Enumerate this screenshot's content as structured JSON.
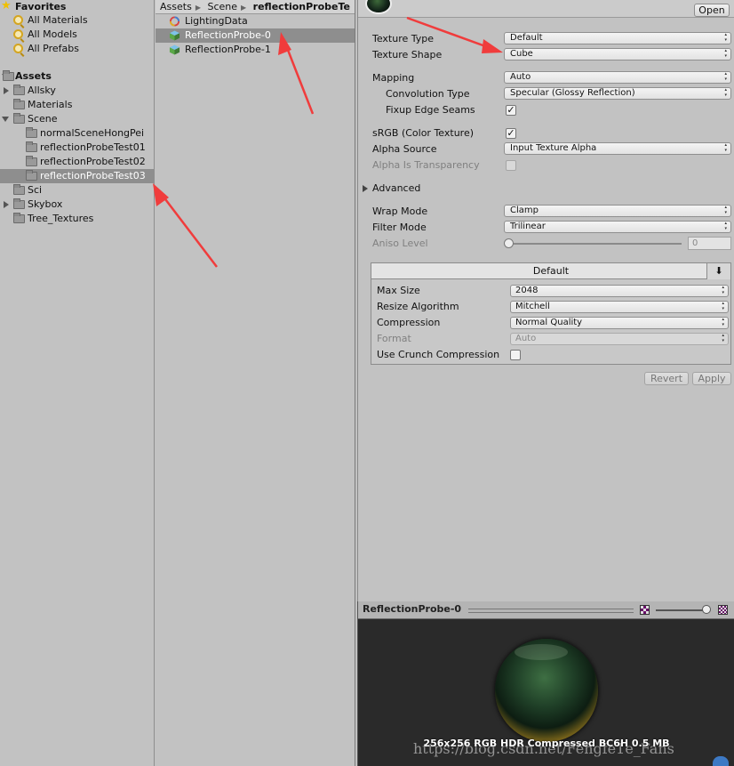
{
  "tree": {
    "favorites_label": "Favorites",
    "favorites": [
      "All Materials",
      "All Models",
      "All Prefabs"
    ],
    "assets_label": "Assets",
    "items": {
      "allsky": "Allsky",
      "materials": "Materials",
      "scene": "Scene",
      "scene_children": [
        "normalSceneHongPei",
        "reflectionProbeTest01",
        "reflectionProbeTest02",
        "reflectionProbeTest03"
      ],
      "sci": "Sci",
      "skybox": "Skybox",
      "tree_textures": "Tree_Textures"
    },
    "selected": "reflectionProbeTest03"
  },
  "breadcrumb": [
    "Assets",
    "Scene",
    "reflectionProbeTe"
  ],
  "files": [
    {
      "name": "LightingData",
      "icon": "lighting-data-icon"
    },
    {
      "name": "ReflectionProbe-0",
      "icon": "cubemap-icon"
    },
    {
      "name": "ReflectionProbe-1",
      "icon": "cubemap-icon"
    }
  ],
  "inspector": {
    "open_label": "Open",
    "texture_type": {
      "label": "Texture Type",
      "value": "Default"
    },
    "texture_shape": {
      "label": "Texture Shape",
      "value": "Cube"
    },
    "mapping": {
      "label": "Mapping",
      "value": "Auto"
    },
    "convolution_type": {
      "label": "Convolution Type",
      "value": "Specular (Glossy Reflection)"
    },
    "fixup_edge_seams": {
      "label": "Fixup Edge Seams",
      "checked": true
    },
    "srgb": {
      "label": "sRGB (Color Texture)",
      "checked": true
    },
    "alpha_source": {
      "label": "Alpha Source",
      "value": "Input Texture Alpha"
    },
    "alpha_is_transparency": {
      "label": "Alpha Is Transparency",
      "checked": false
    },
    "advanced": "Advanced",
    "wrap_mode": {
      "label": "Wrap Mode",
      "value": "Clamp"
    },
    "filter_mode": {
      "label": "Filter Mode",
      "value": "Trilinear"
    },
    "aniso_level": {
      "label": "Aniso Level",
      "value": "0"
    },
    "platform": {
      "tab": "Default",
      "max_size": {
        "label": "Max Size",
        "value": "2048"
      },
      "resize_algorithm": {
        "label": "Resize Algorithm",
        "value": "Mitchell"
      },
      "compression": {
        "label": "Compression",
        "value": "Normal Quality"
      },
      "format": {
        "label": "Format",
        "value": "Auto"
      },
      "use_crunch": {
        "label": "Use Crunch Compression",
        "checked": false
      }
    },
    "revert_label": "Revert",
    "apply_label": "Apply"
  },
  "preview": {
    "title": "ReflectionProbe-0",
    "info": "256x256  RGB HDR Compressed BC6H   0.5 MB",
    "watermark": "https://blog.csdn.net/Fengfe1e_Fans"
  },
  "colors": {
    "annotation_arrow": "#f03c3c",
    "selection": "#8e8e8e",
    "panel_bg": "#c2c2c2"
  }
}
